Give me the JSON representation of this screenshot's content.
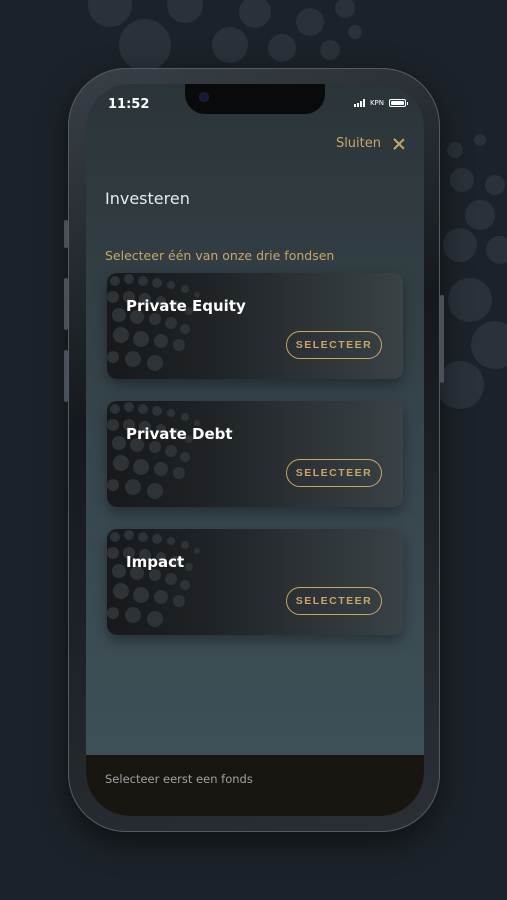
{
  "status_bar": {
    "time": "11:52",
    "carrier": "KPN"
  },
  "header": {
    "close_label": "Sluiten"
  },
  "page": {
    "title": "Investeren",
    "subtitle": "Selecteer één van onze drie fondsen"
  },
  "funds": [
    {
      "name": "Private Equity",
      "button_label": "SELECTEER"
    },
    {
      "name": "Private Debt",
      "button_label": "SELECTEER"
    },
    {
      "name": "Impact",
      "button_label": "SELECTEER"
    }
  ],
  "footer": {
    "text": "Selecteer eerst een fonds",
    "background": "#191612"
  },
  "colors": {
    "accent": "#c9a56b",
    "background": "#1c2229"
  }
}
